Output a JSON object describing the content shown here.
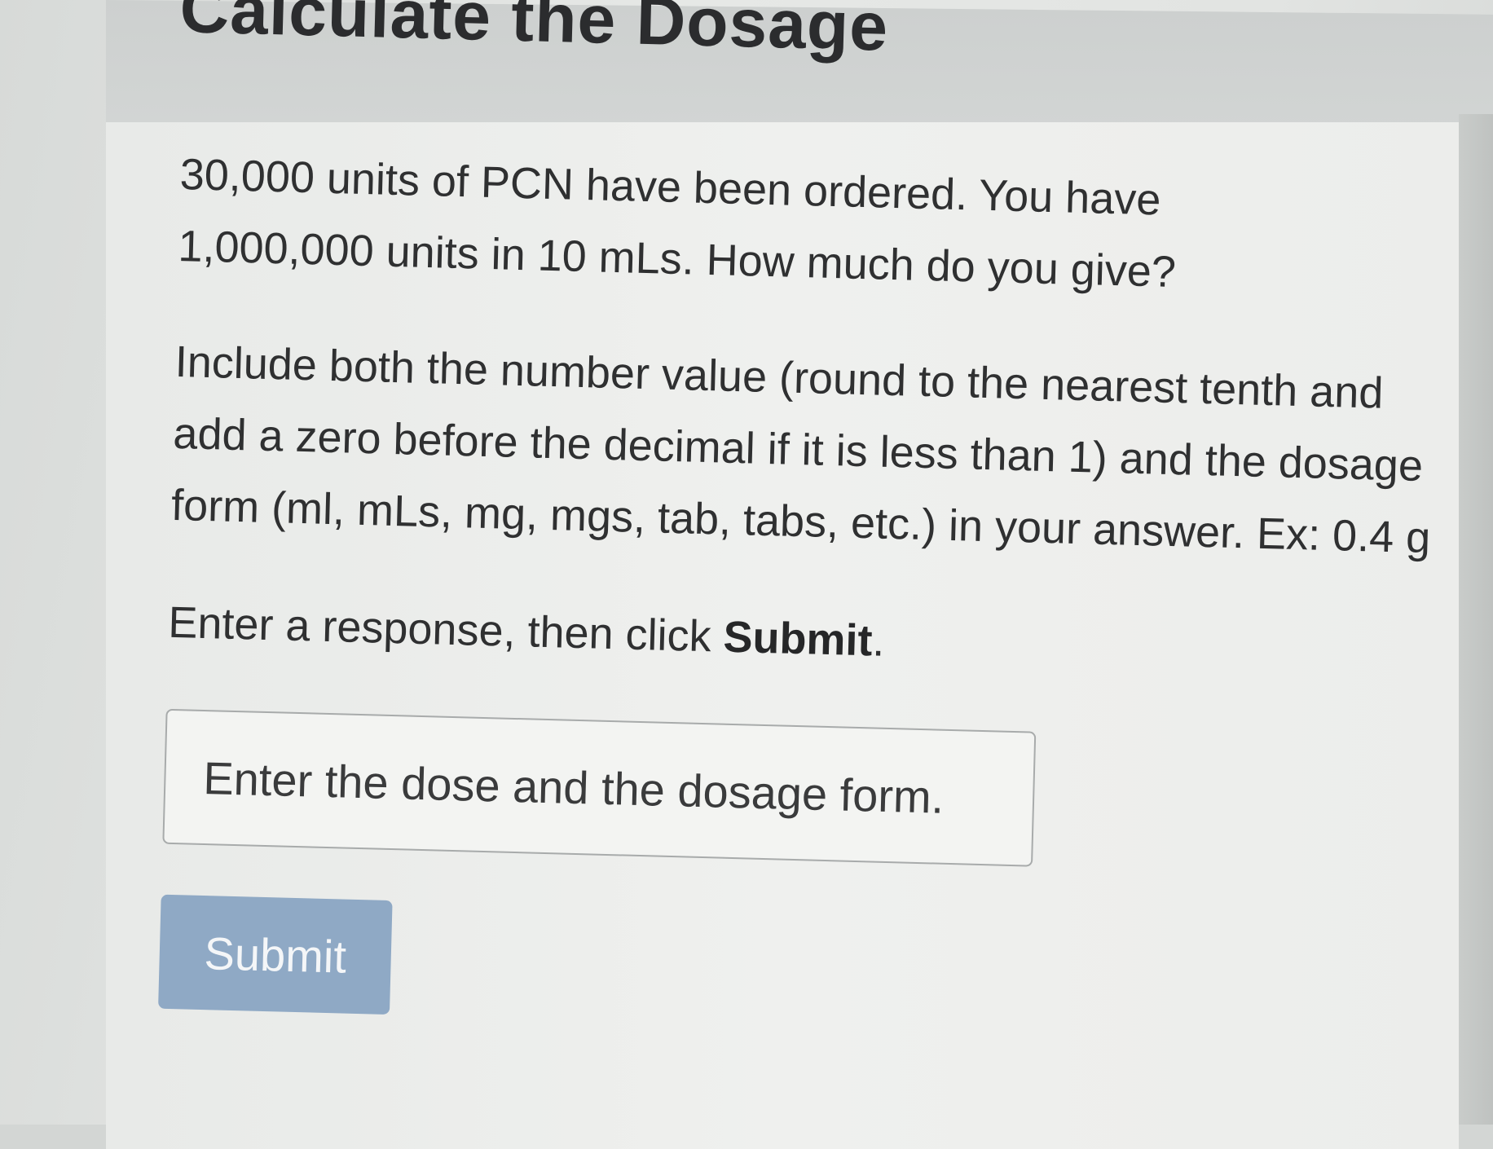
{
  "page": {
    "title": "Calculate the Dosage"
  },
  "question": {
    "text": "30,000 units of PCN have been ordered. You have 1,000,000 units in 10 mLs. How much do you give?"
  },
  "instructions": {
    "text": "Include both the number value (round to the nearest tenth and add a zero before the decimal if it is less than 1) and the dosage form (ml, mLs, mg, mgs, tab, tabs, etc.) in your answer. Ex: 0.4 g"
  },
  "prompt": {
    "text_before": "Enter a response, then click ",
    "bold": "Submit",
    "text_after": "."
  },
  "answer": {
    "placeholder": "Enter the dose and the dosage form.",
    "value": ""
  },
  "submit": {
    "label": "Submit"
  },
  "colors": {
    "submit_button": "#8fa9c5",
    "text": "#2f3031",
    "panel": "#eff0ee",
    "header_band": "#cdd0cf"
  }
}
